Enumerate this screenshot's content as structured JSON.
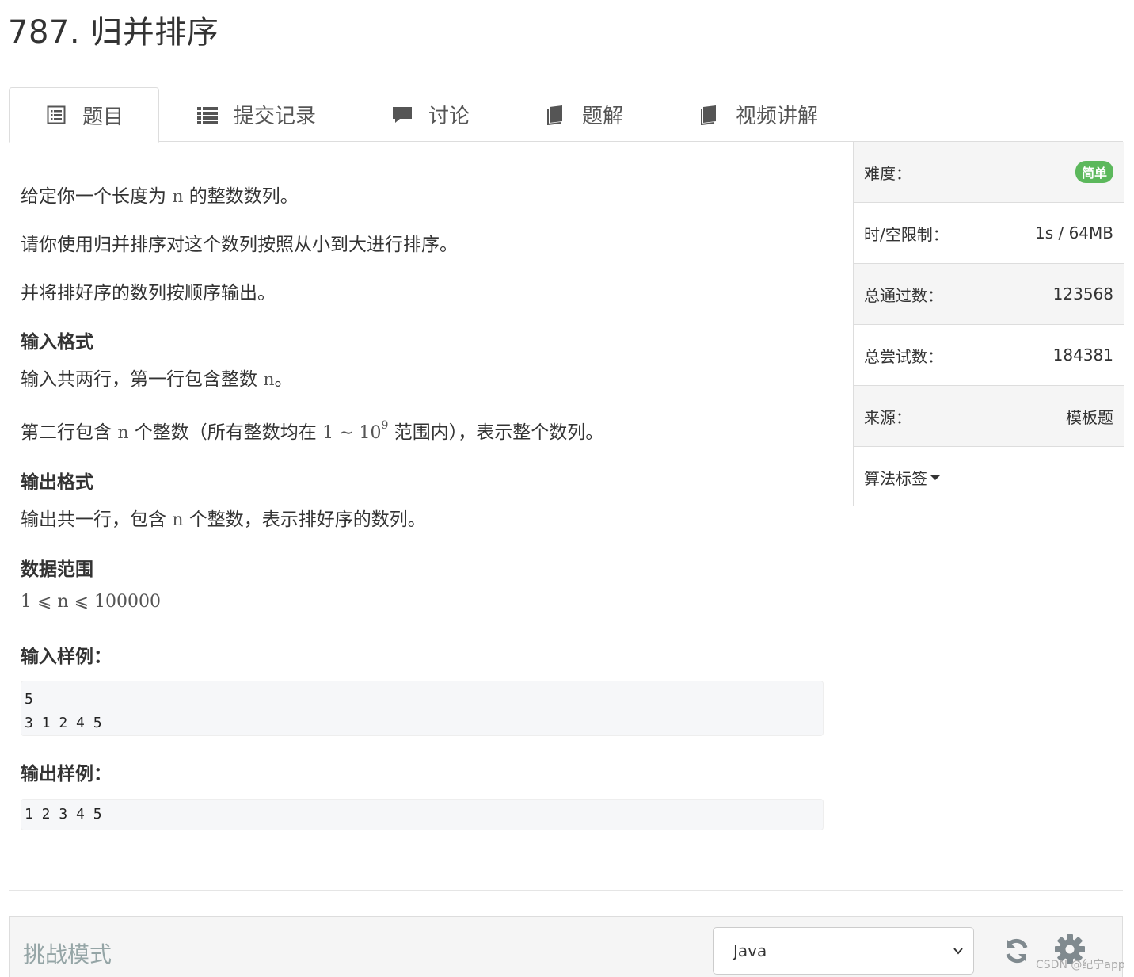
{
  "title": "787. 归并排序",
  "tabs": [
    {
      "label": "题目",
      "icon": "list-alt-icon"
    },
    {
      "label": "提交记录",
      "icon": "list-icon"
    },
    {
      "label": "讨论",
      "icon": "comment-icon"
    },
    {
      "label": "题解",
      "icon": "book-icon"
    },
    {
      "label": "视频讲解",
      "icon": "book-icon"
    }
  ],
  "problem": {
    "p1_pre": "给定你一个长度为 ",
    "p1_var": "n",
    "p1_post": " 的整数数列。",
    "p2": "请你使用归并排序对这个数列按照从小到大进行排序。",
    "p3": "并将排好序的数列按顺序输出。",
    "input_heading": "输入格式",
    "input_l1_pre": "输入共两行，第一行包含整数 ",
    "input_l1_var": "n",
    "input_l1_post": "。",
    "input_l2_pre": "第二行包含 ",
    "input_l2_var": "n",
    "input_l2_mid": " 个整数（所有整数均在 ",
    "input_l2_range": "1 ∼ 10",
    "input_l2_exp": "9",
    "input_l2_post": " 范围内），表示整个数列。",
    "output_heading": "输出格式",
    "output_pre": "输出共一行，包含 ",
    "output_var": "n",
    "output_post": " 个整数，表示排好序的数列。",
    "range_heading": "数据范围",
    "range_expr": "1 ⩽ n ⩽ 100000",
    "sample_in_heading": "输入样例：",
    "sample_in": "5\n3 1 2 4 5",
    "sample_out_heading": "输出样例：",
    "sample_out": "1 2 3 4 5"
  },
  "sidebar": {
    "difficulty_label": "难度：",
    "difficulty_value": "简单",
    "difficulty_color": "#5cb85c",
    "limit_label": "时/空限制：",
    "limit_value": "1s / 64MB",
    "passed_label": "总通过数：",
    "passed_value": "123568",
    "tried_label": "总尝试数：",
    "tried_value": "184381",
    "source_label": "来源：",
    "source_value": "模板题",
    "tags_label": "算法标签"
  },
  "editor": {
    "mode_label": "挑战模式",
    "language": "Java",
    "refresh_icon": "refresh-icon",
    "settings_icon": "gear-icon"
  },
  "watermark": "CSDN @纪宁app"
}
